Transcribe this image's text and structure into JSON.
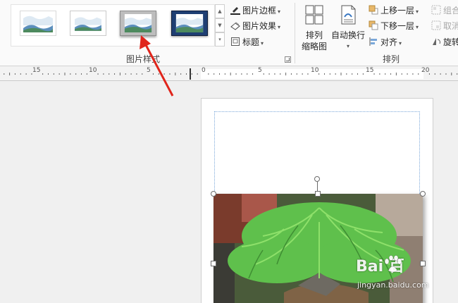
{
  "ribbon": {
    "picture_styles": {
      "group_label": "图片样式",
      "commands": {
        "border": "图片边框",
        "effects": "图片效果",
        "caption": "标题"
      }
    },
    "arrange": {
      "group_label": "排列",
      "arrange_thumbnails": [
        "排列",
        "缩略图"
      ],
      "wrap_text": "自动换行",
      "bring_forward": "上移一层",
      "send_backward": "下移一层",
      "align": "对齐",
      "group": "组合",
      "ungroup": "取消",
      "rotate": "旋转"
    }
  },
  "ruler": {
    "labels": [
      "15",
      "10",
      "5",
      "0",
      "5",
      "10",
      "15",
      "20"
    ]
  },
  "watermark": {
    "brand": "Bai  百",
    "site": "jingyan.baidu.com"
  },
  "colors": {
    "accent_arrow": "#e0251b",
    "selection_border": "#7aa7d9",
    "picture_frame_dark": "#1f3f73"
  }
}
